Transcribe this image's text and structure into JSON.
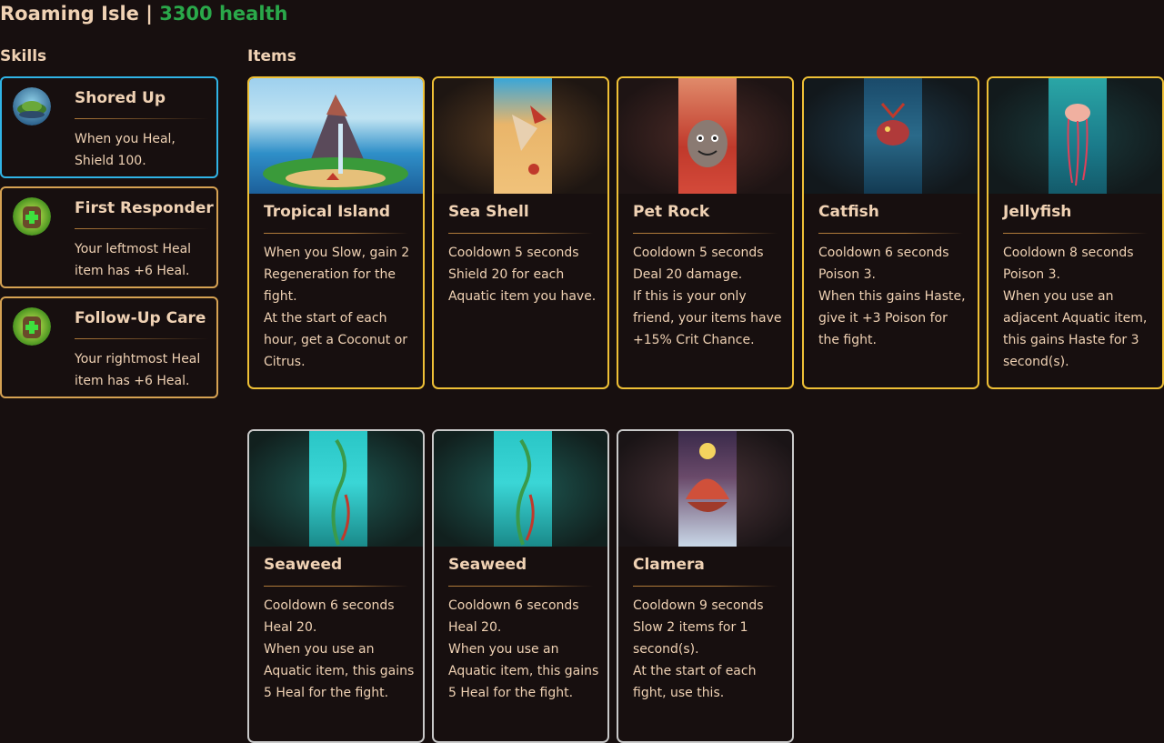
{
  "header": {
    "name": "Roaming Isle",
    "separator": "|",
    "health": "3300 health"
  },
  "sections": {
    "skills": "Skills",
    "items": "Items"
  },
  "skills": [
    {
      "name": "Shored Up",
      "text": "When you Heal, Shield 100.",
      "icon": "island-icon"
    },
    {
      "name": "First Responder",
      "text": "Your leftmost Heal item has +6 Heal.",
      "icon": "medkit-backpack-icon"
    },
    {
      "name": "Follow-Up Care",
      "text": "Your rightmost Heal item has +6 Heal.",
      "icon": "medkit-backpack-icon"
    }
  ],
  "items": [
    {
      "name": "Tropical Island",
      "lines": [
        "When you Slow, gain 2 Regeneration for the fight.",
        "At the start of each hour, get a Coconut or Citrus."
      ],
      "tier": "gold"
    },
    {
      "name": "Sea Shell",
      "lines": [
        "Cooldown 5 seconds",
        "Shield 20 for each Aquatic item you have."
      ],
      "tier": "gold"
    },
    {
      "name": "Pet Rock",
      "lines": [
        "Cooldown 5 seconds",
        "Deal 20 damage.",
        "If this is your only friend, your items have +15% Crit Chance."
      ],
      "tier": "gold"
    },
    {
      "name": "Catfish",
      "lines": [
        "Cooldown 6 seconds",
        "Poison 3.",
        "When this gains Haste, give it +3 Poison for the fight."
      ],
      "tier": "gold"
    },
    {
      "name": "Jellyfish",
      "lines": [
        "Cooldown 8 seconds",
        "Poison 3.",
        "When you use an adjacent Aquatic item, this gains Haste for 3 second(s)."
      ],
      "tier": "gold"
    },
    {
      "name": "Seaweed",
      "lines": [
        "Cooldown 6 seconds",
        "Heal 20.",
        "When you use an Aquatic item, this gains 5 Heal for the fight."
      ],
      "tier": "silver"
    },
    {
      "name": "Seaweed",
      "lines": [
        "Cooldown 6 seconds",
        "Heal 20.",
        "When you use an Aquatic item, this gains 5 Heal for the fight."
      ],
      "tier": "silver"
    },
    {
      "name": "Clamera",
      "lines": [
        "Cooldown 9 seconds",
        "Slow 2 items for 1 second(s).",
        "At the start of each fight, use this."
      ],
      "tier": "silver"
    }
  ],
  "colors": {
    "background": "#170f0f",
    "text": "#f0d2b4",
    "health": "#2aa84a",
    "gold_border": "#efc036",
    "silver_border": "#c9c9c9",
    "skill_border": "#d6a253",
    "skill_highlight": "#30b4e6"
  }
}
